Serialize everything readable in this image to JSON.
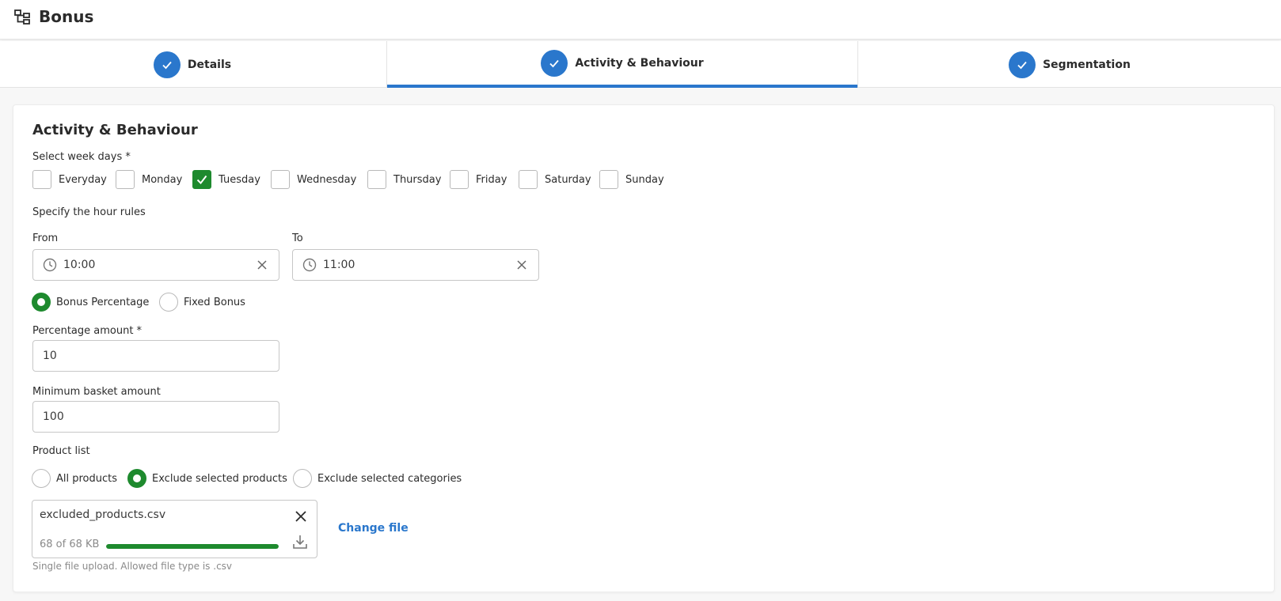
{
  "header": {
    "title": "Bonus",
    "icon": "hierarchy-icon"
  },
  "steps": [
    {
      "label": "Details",
      "completed": true,
      "active": false
    },
    {
      "label": "Activity & Behaviour",
      "completed": true,
      "active": true
    },
    {
      "label": "Segmentation",
      "completed": true,
      "active": false
    }
  ],
  "form": {
    "section_title": "Activity & Behaviour",
    "week_days_label": "Select week days *",
    "week_days": [
      {
        "label": "Everyday",
        "checked": false
      },
      {
        "label": "Monday",
        "checked": false
      },
      {
        "label": "Tuesday",
        "checked": true
      },
      {
        "label": "Wednesday",
        "checked": false
      },
      {
        "label": "Thursday",
        "checked": false
      },
      {
        "label": "Friday",
        "checked": false
      },
      {
        "label": "Saturday",
        "checked": false
      },
      {
        "label": "Sunday",
        "checked": false
      }
    ],
    "hour_rules_label": "Specify the hour rules",
    "from": {
      "label": "From",
      "value": "10:00"
    },
    "to": {
      "label": "To",
      "value": "11:00"
    },
    "bonus_type": {
      "options": [
        "Bonus Percentage",
        "Fixed Bonus"
      ],
      "selected": "Bonus Percentage"
    },
    "percentage_amount": {
      "label": "Percentage amount *",
      "value": "10"
    },
    "minimum_basket": {
      "label": "Minimum basket amount",
      "value": "100"
    },
    "product_list": {
      "label": "Product list",
      "options": [
        "All products",
        "Exclude selected products",
        "Exclude selected categories"
      ],
      "selected": "Exclude selected products"
    },
    "file": {
      "name": "excluded_products.csv",
      "size_text": "68 of 68 KB",
      "progress": 1.0,
      "change_label": "Change file",
      "hint": "Single file upload. Allowed file type is .csv"
    }
  },
  "colors": {
    "accent": "#2a77cc",
    "success": "#1e8a2e"
  }
}
